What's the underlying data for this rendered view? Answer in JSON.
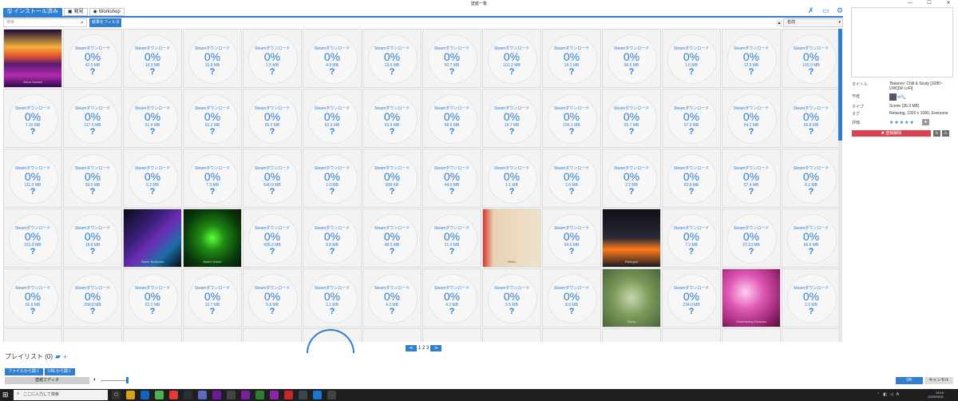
{
  "window": {
    "title": "壁紙一覧",
    "controls": [
      "—",
      "☐",
      "✕"
    ]
  },
  "tabs": [
    {
      "label": "インストール済み",
      "icon": "save-icon"
    },
    {
      "label": "発見",
      "icon": "discover-icon"
    },
    {
      "label": "Workshop",
      "icon": "steam-icon"
    }
  ],
  "search": {
    "placeholder": "検索"
  },
  "filter": {
    "label": "結果をフィルター ▼"
  },
  "sort": {
    "value": "名前"
  },
  "tile_text": {
    "label": "Steamダウンロード",
    "percent": "0%",
    "unknown": "?"
  },
  "grid": {
    "rows": [
      [
        "@Neon Sunset",
        "42.0 MB",
        "16.3 MB",
        "15.9 MB",
        "1.5 MB",
        "4.9 MB",
        "23.6 MB",
        "50.7 MB",
        "101.2 MB",
        "19.2 MB",
        "66.6 MB",
        "1.6 MB",
        "12.9 MB",
        "165.9 MB"
      ],
      [
        "7.10 MB",
        "117.5 MB",
        "51.4 MB",
        "53.2 MB",
        "55.2 MB",
        "53.3 MB",
        "53.9 MB",
        "58.6 MB",
        "19.7 MB",
        "156.1 MB",
        "55.7 MB",
        "57.9 MB",
        "54.2 MB",
        "55.8 MB"
      ],
      [
        "111.0 MB",
        "59.5 MB",
        "5.2 MB",
        "7.3 MB",
        "640.9 MB",
        "1.0 MB",
        "998 KB",
        "44.0 MB",
        "1.1 MB",
        "2.6 MB",
        "2.2 MB",
        "63.8 MB",
        "57.4 MB",
        "8.1 MB"
      ],
      [
        "331.0 MB",
        "18.8 MB",
        "@Razer Bedroom",
        "@Razer Vortex",
        "439.3 MB",
        "9.8 MB",
        "48.5 MB",
        "21.2 MB",
        "@Retro",
        "54.5 MB",
        "@Ravegod",
        "7.2 MB",
        "22.10 MB",
        "66.6 MB"
      ],
      [
        "56.9 MB",
        "258.8 MB",
        "22.2 MB",
        "10.7 MB",
        "5.8 MB",
        "3.1 MB",
        "4.2 MB",
        "4.2 MB",
        "5.5 MB",
        "8.6 MB",
        "@Sheep",
        "234.0 MB",
        "@Shimmering Particles",
        "2.3 MB"
      ]
    ]
  },
  "pager": {
    "prev": "≪",
    "pages": "1 2 3",
    "next": "≫"
  },
  "playlist": {
    "label": "プレイリスト (0)"
  },
  "buttons": {
    "open_file": "ファイルから開く",
    "open_url": "URLから開く",
    "editor": "壁紙エディタ",
    "ok": "OK",
    "cancel": "キャンセル"
  },
  "details": {
    "title_key": "タイトル",
    "title_val": "'Balance' Chill & Study [1080~ UWQW LoFi]",
    "author_key": "作者",
    "type_key": "タイプ",
    "type_val": "Scene (36.3 MB)",
    "tags_key": "タグ",
    "tags_val": "Relaxing, 1920 x 1080, Everyone",
    "rating_key": "評価",
    "rating_val": "★★★★★",
    "unsubscribe": "✖ 登録解除"
  },
  "taskbar": {
    "search_placeholder": "ここに入力して検索",
    "time": "19:16",
    "date": "2020/09/11"
  }
}
